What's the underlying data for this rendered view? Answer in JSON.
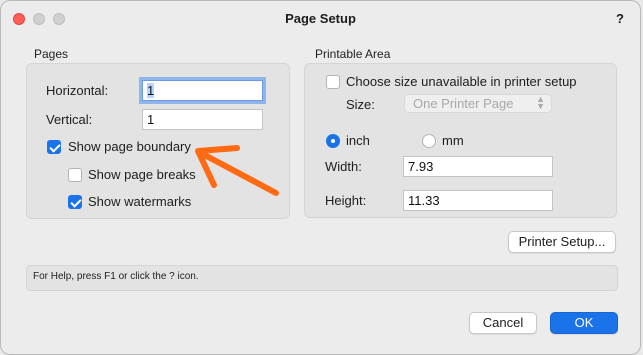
{
  "window": {
    "title": "Page Setup",
    "help_glyph": "?"
  },
  "pages": {
    "section_label": "Pages",
    "horizontal_label": "Horizontal:",
    "horizontal_value": "1",
    "vertical_label": "Vertical:",
    "vertical_value": "1",
    "show_page_boundary": {
      "label": "Show page boundary",
      "checked": true
    },
    "show_page_breaks": {
      "label": "Show page breaks",
      "checked": false
    },
    "show_watermarks": {
      "label": "Show watermarks",
      "checked": true
    }
  },
  "printable_area": {
    "section_label": "Printable Area",
    "choose_size": {
      "label": "Choose size unavailable in printer setup",
      "checked": false
    },
    "size_label": "Size:",
    "size_value": "One Printer Page",
    "unit_inch_label": "inch",
    "unit_mm_label": "mm",
    "selected_unit": "inch",
    "width_label": "Width:",
    "width_value": "7.93",
    "height_label": "Height:",
    "height_value": "11.33"
  },
  "printer_setup_button": "Printer Setup...",
  "help_text": "For Help, press F1 or click the ? icon.",
  "footer": {
    "cancel_label": "Cancel",
    "ok_label": "OK"
  },
  "colors": {
    "accent": "#1a73e8",
    "annotation_arrow": "#ff6a13"
  }
}
